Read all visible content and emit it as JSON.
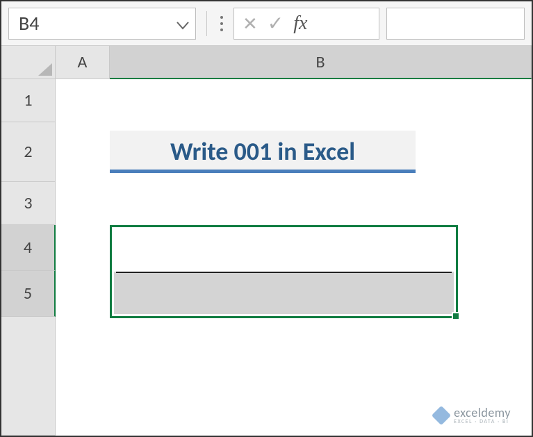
{
  "namebox": {
    "value": "B4"
  },
  "formula_bar": {
    "cancel_glyph": "✕",
    "enter_glyph": "✓",
    "fx_label": "fx",
    "value": ""
  },
  "columns": [
    "A",
    "B"
  ],
  "rows": [
    "1",
    "2",
    "3",
    "4",
    "5"
  ],
  "cells": {
    "B2": "Write 001 in Excel",
    "B4": "",
    "B5": ""
  },
  "selection": {
    "range": "B4:B5",
    "active": "B4"
  },
  "watermark": {
    "brand": "exceldemy",
    "tagline": "EXCEL · DATA · BI"
  }
}
